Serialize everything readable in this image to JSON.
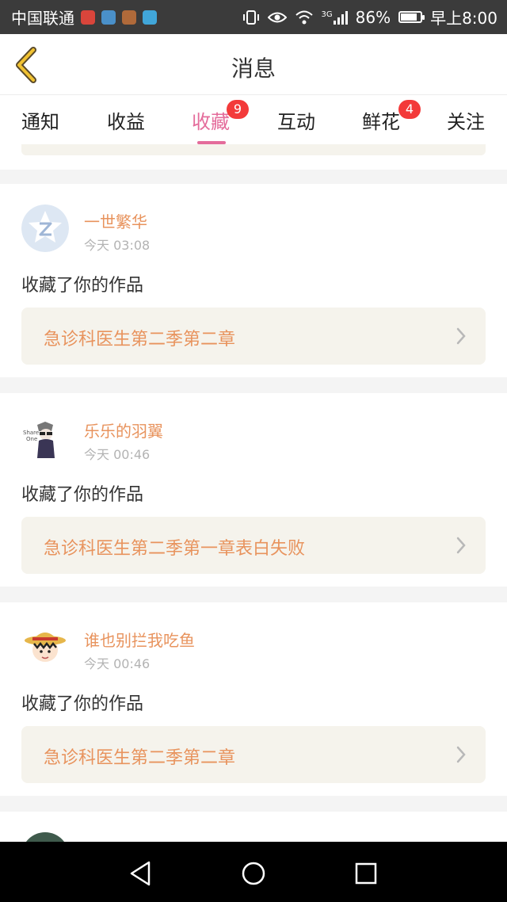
{
  "status_bar": {
    "carrier": "中国联通",
    "network": "3G",
    "battery": "86%",
    "battery_level": 0.86,
    "time": "早上8:00"
  },
  "header": {
    "title": "消息"
  },
  "tabs": [
    {
      "label": "通知"
    },
    {
      "label": "收益"
    },
    {
      "label": "收藏",
      "badge": "9",
      "active": true
    },
    {
      "label": "互动"
    },
    {
      "label": "鲜花",
      "badge": "4"
    },
    {
      "label": "关注"
    }
  ],
  "messages": [
    {
      "user": "一世繁华",
      "time": "今天 03:08",
      "action": "收藏了你的作品",
      "work": "急诊科医生第二季第二章"
    },
    {
      "user": "乐乐的羽翼",
      "time": "今天 00:46",
      "action": "收藏了你的作品",
      "work": "急诊科医生第二季第一章表白失败"
    },
    {
      "user": "谁也别拦我吃鱼",
      "time": "今天 00:46",
      "action": "收藏了你的作品",
      "work": "急诊科医生第二季第二章"
    }
  ],
  "colors": {
    "accent": "#e46c9b",
    "username": "#e8935d",
    "badge": "#f33a3a",
    "work_bg": "#f5f3ec"
  }
}
